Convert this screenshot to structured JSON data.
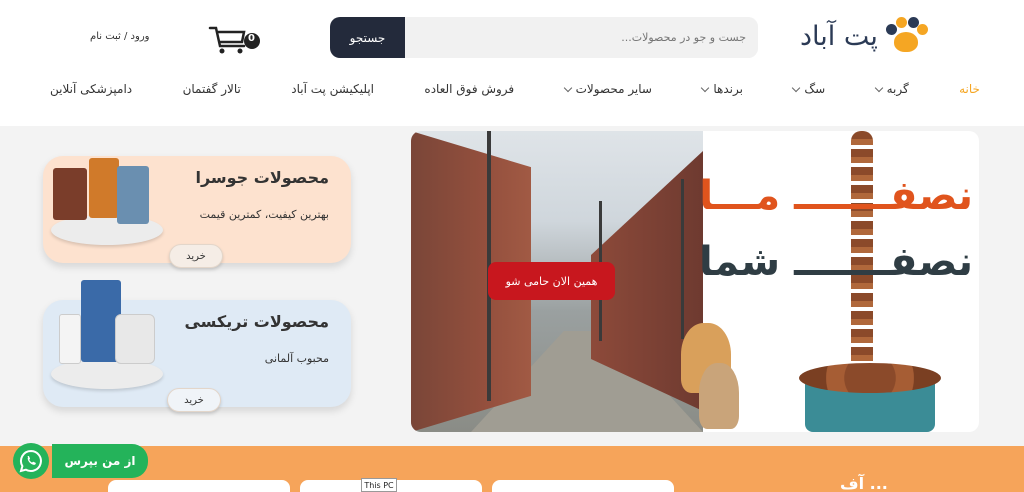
{
  "brand": {
    "name": "پت آباد",
    "accent": "#f5a623",
    "text_color": "#2b3a55"
  },
  "search": {
    "button_label": "جستجو",
    "placeholder": "جست و جو در محصولات..."
  },
  "header": {
    "login_label": "ورود / ثبت نام",
    "cart_count": "0",
    "cart_icon": "cart-icon"
  },
  "nav": {
    "items": [
      {
        "label": "خانه",
        "active": true,
        "dropdown": false
      },
      {
        "label": "گربه",
        "active": false,
        "dropdown": true
      },
      {
        "label": "سگ",
        "active": false,
        "dropdown": true
      },
      {
        "label": "برندها",
        "active": false,
        "dropdown": true
      },
      {
        "label": "سایر محصولات",
        "active": false,
        "dropdown": true
      },
      {
        "label": "فروش فوق العاده",
        "active": false,
        "dropdown": false
      },
      {
        "label": "اپلیکیشن پت آباد",
        "active": false,
        "dropdown": false
      },
      {
        "label": "تالار گفتمان",
        "active": false,
        "dropdown": false
      },
      {
        "label": "دامپزشکی آنلاین",
        "active": false,
        "dropdown": false
      }
    ]
  },
  "banner": {
    "line1": "نصفـــــــ مـــا",
    "line2": "نصفـــــــ شما",
    "button_label": "همین الان حامی شو",
    "button_color": "#c8171e"
  },
  "cards": [
    {
      "title": "محصولات جوسرا",
      "subtitle": "بهترین کیفیت، کمترین قیمت",
      "buy_label": "خرید",
      "bg": "#fde2cf"
    },
    {
      "title": "محصولات تریکسی",
      "subtitle": "محبوب آلمانی",
      "buy_label": "خرید",
      "bg": "#dfeaf5"
    }
  ],
  "footer": {
    "ask_label": "از من بپرس",
    "whatsapp_icon": "whatsapp-icon",
    "peek_text": "... آف",
    "thispc_label": "This PC",
    "orange": "#f6a45a"
  }
}
